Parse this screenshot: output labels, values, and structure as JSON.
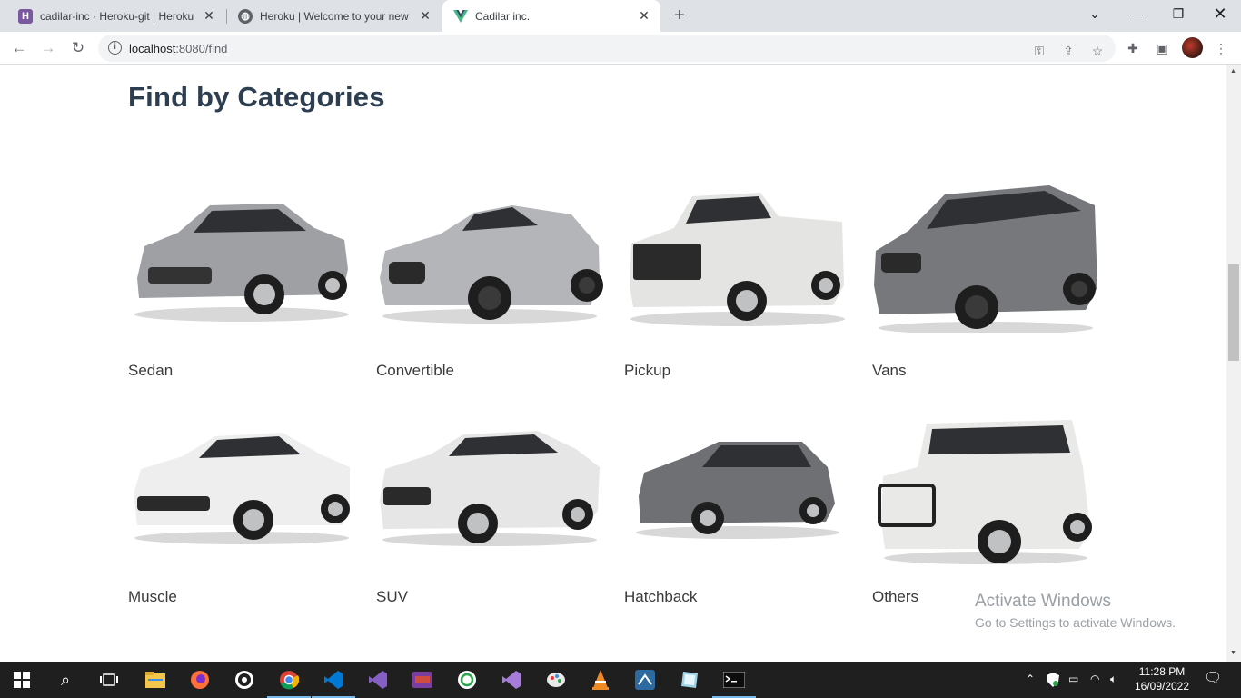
{
  "browser": {
    "tabs": [
      {
        "title": "cadilar-inc · Heroku-git | Heroku",
        "icon": "heroku-icon",
        "active": false
      },
      {
        "title": "Heroku | Welcome to your new a",
        "icon": "globe-icon",
        "active": false
      },
      {
        "title": "Cadilar inc.",
        "icon": "vue-icon",
        "active": true
      }
    ],
    "url_host": "localhost",
    "url_path": ":8080/find"
  },
  "page": {
    "title": "Find by Categories",
    "categories": [
      {
        "label": "Sedan",
        "color": "#9ea0a3"
      },
      {
        "label": "Convertible",
        "color": "#b3b5b8"
      },
      {
        "label": "Pickup",
        "color": "#e4e4e2"
      },
      {
        "label": "Vans",
        "color": "#76787b"
      },
      {
        "label": "Muscle",
        "color": "#eeeeee"
      },
      {
        "label": "SUV",
        "color": "#e6e6e6"
      },
      {
        "label": "Hatchback",
        "color": "#6f7073"
      },
      {
        "label": "Others",
        "color": "#e9e9e7"
      }
    ]
  },
  "watermark": {
    "line1": "Activate Windows",
    "line2": "Go to Settings to activate Windows."
  },
  "taskbar": {
    "time": "11:28 PM",
    "date": "16/09/2022"
  }
}
